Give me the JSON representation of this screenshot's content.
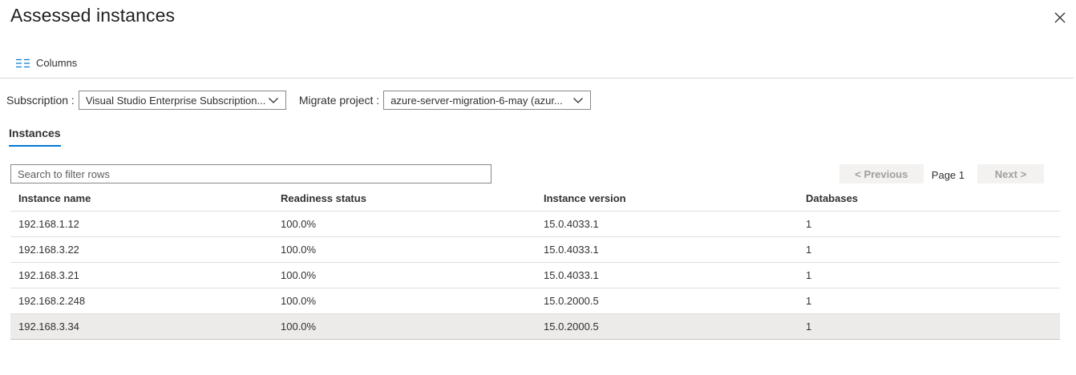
{
  "header": {
    "title": "Assessed instances",
    "close_icon": "close-icon"
  },
  "toolbar": {
    "columns_label": "Columns",
    "columns_icon": "columns-icon"
  },
  "filters": {
    "subscription_label": "Subscription :",
    "subscription_value": "Visual Studio Enterprise Subscription...",
    "project_label": "Migrate project :",
    "project_value": "azure-server-migration-6-may (azur..."
  },
  "tabs": [
    {
      "label": "Instances",
      "active": true
    }
  ],
  "search": {
    "placeholder": "Search to filter rows",
    "value": ""
  },
  "pager": {
    "previous_label": "< Previous",
    "page_label": "Page 1",
    "next_label": "Next >"
  },
  "table": {
    "columns": [
      "Instance name",
      "Readiness status",
      "Instance version",
      "Databases"
    ],
    "rows": [
      [
        "192.168.1.12",
        "100.0%",
        "15.0.4033.1",
        "1"
      ],
      [
        "192.168.3.22",
        "100.0%",
        "15.0.4033.1",
        "1"
      ],
      [
        "192.168.3.21",
        "100.0%",
        "15.0.4033.1",
        "1"
      ],
      [
        "192.168.2.248",
        "100.0%",
        "15.0.2000.5",
        "1"
      ],
      [
        "192.168.3.34",
        "100.0%",
        "15.0.2000.5",
        "1"
      ]
    ],
    "selected_row": 4
  },
  "colors": {
    "accent": "#0078d4",
    "text": "#323130",
    "selected_row_bg": "#edebe9",
    "disabled_button_bg": "#f3f2f1"
  }
}
